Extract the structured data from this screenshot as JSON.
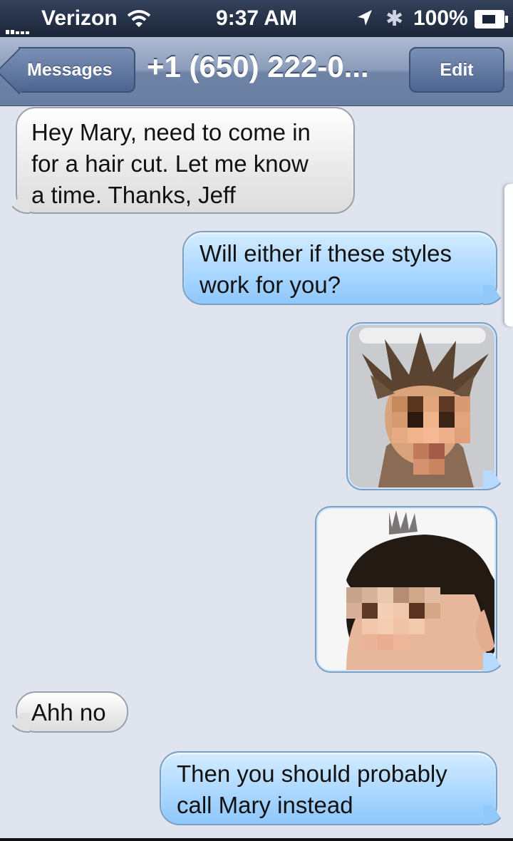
{
  "status_bar": {
    "carrier": "Verizon",
    "time": "9:37 AM",
    "battery": "100%"
  },
  "nav": {
    "back_label": "Messages",
    "title": "+1 (650) 222-0...",
    "edit_label": "Edit"
  },
  "messages": [
    {
      "from": "them",
      "lines": [
        "Hey Mary, need to come in",
        "for a hair cut. Let me know",
        "a time. Thanks, Jeff"
      ]
    },
    {
      "from": "me",
      "lines": [
        "Will either if these styles",
        "work for you?"
      ]
    },
    {
      "from": "me",
      "type": "image",
      "icon": "photo-spiky-hair"
    },
    {
      "from": "me",
      "type": "image",
      "icon": "photo-short-bowl-cut"
    },
    {
      "from": "them",
      "lines": [
        "Ahh no"
      ]
    },
    {
      "from": "me",
      "lines": [
        "Then you should probably",
        "call Mary instead"
      ]
    }
  ],
  "colors": {
    "background": "#dfe4ee",
    "outgoing_bubble": "#a8d6ff",
    "incoming_bubble": "#e9e9e9",
    "nav_bar": "#8a9bba"
  }
}
